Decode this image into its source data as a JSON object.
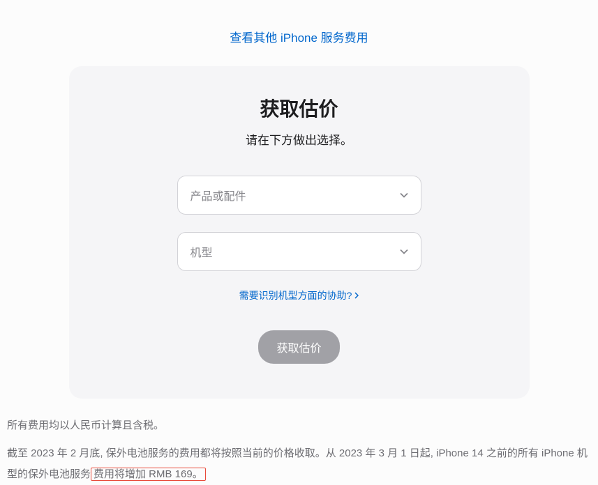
{
  "topLink": "查看其他 iPhone 服务费用",
  "card": {
    "title": "获取估价",
    "subtitle": "请在下方做出选择。",
    "selectProduct": "产品或配件",
    "selectModel": "机型",
    "helpLink": "需要识别机型方面的协助?",
    "submitLabel": "获取估价"
  },
  "footer": {
    "line1": "所有费用均以人民币计算且含税。",
    "line2_part1": "截至 2023 年 2 月底, 保外电池服务的费用都将按照当前的价格收取。从 2023 年 3 月 1 日起, iPhone 14 之前的所有 iPhone 机型的保外电池服务",
    "line2_highlight": "费用将增加 RMB 169。"
  }
}
